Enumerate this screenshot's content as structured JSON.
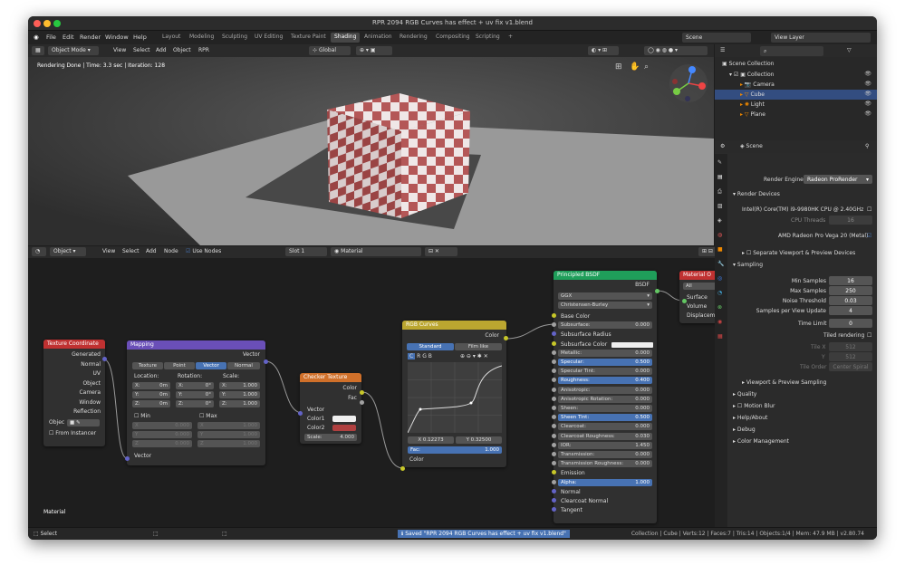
{
  "window": {
    "title": "RPR 2094 RGB Curves has effect + uv fix v1.blend"
  },
  "menu": {
    "items": [
      "File",
      "Edit",
      "Render",
      "Window",
      "Help"
    ]
  },
  "workspaces": {
    "tabs": [
      "Layout",
      "Modeling",
      "Sculpting",
      "UV Editing",
      "Texture Paint",
      "Shading",
      "Animation",
      "Rendering",
      "Compositing",
      "Scripting"
    ],
    "active": "Shading",
    "add": "+"
  },
  "topright": {
    "scene": "Scene",
    "view_layer": "View Layer"
  },
  "viewport": {
    "mode": "Object Mode",
    "menu": [
      "View",
      "Select",
      "Add",
      "Object",
      "RPR"
    ],
    "transform": "Global",
    "status": "Rendering Done | Time: 3.3 sec | Iteration: 128"
  },
  "node_editor": {
    "type": "Object",
    "menu": [
      "View",
      "Select",
      "Add",
      "Node"
    ],
    "use_nodes": "Use Nodes",
    "slot": "Slot 1",
    "material": "Material",
    "footer_label": "Material"
  },
  "nodes": {
    "texcoord": {
      "title": "Texture Coordinate",
      "outputs": [
        "Generated",
        "Normal",
        "UV",
        "Object",
        "Camera",
        "Window",
        "Reflection"
      ],
      "object_label": "Objec",
      "from_instancer": "From Instancer"
    },
    "mapping": {
      "title": "Mapping",
      "output": "Vector",
      "types": [
        "Texture",
        "Point",
        "Vector",
        "Normal"
      ],
      "active_type": "Vector",
      "headers": [
        "Location:",
        "Rotation:",
        "Scale:"
      ],
      "rows": [
        {
          "axis": "X:",
          "loc": "0m",
          "rot": "0°",
          "scale": "1.000"
        },
        {
          "axis": "Y:",
          "loc": "0m",
          "rot": "0°",
          "scale": "1.000"
        },
        {
          "axis": "Z:",
          "loc": "0m",
          "rot": "0°",
          "scale": "1.000"
        }
      ],
      "min": "Min",
      "max": "Max",
      "minmax_rows": [
        {
          "axis": "X",
          "a": "0.000",
          "b": "1.000"
        },
        {
          "axis": "Y",
          "a": "0.000",
          "b": "1.000"
        },
        {
          "axis": "Z",
          "a": "0.000",
          "b": "1.000"
        }
      ],
      "input": "Vector"
    },
    "checker": {
      "title": "Checker Texture",
      "outputs": [
        "Color",
        "Fac"
      ],
      "inputs": [
        "Vector",
        "Color1",
        "Color2"
      ],
      "scale_label": "Scale:",
      "scale_value": "4.000"
    },
    "curves": {
      "title": "RGB Curves",
      "output": "Color",
      "modes": [
        "Standard",
        "Film like"
      ],
      "active_mode": "Standard",
      "channels": [
        "C",
        "R",
        "G",
        "B"
      ],
      "x_label": "X 0.12273",
      "y_label": "Y 0.32500",
      "fac_label": "Fac:",
      "fac_value": "1.000",
      "input": "Color"
    },
    "bsdf": {
      "title": "Principled BSDF",
      "output": "BSDF",
      "dist": "GGX",
      "sss": "Christensen-Burley",
      "inputs": [
        {
          "label": "Base Color",
          "value": ""
        },
        {
          "label": "Subsurface:",
          "value": "0.000"
        },
        {
          "label": "Subsurface Radius",
          "value": ""
        },
        {
          "label": "Subsurface Color",
          "value": ""
        },
        {
          "label": "Metallic:",
          "value": "0.000"
        },
        {
          "label": "Specular:",
          "value": "0.500"
        },
        {
          "label": "Specular Tint:",
          "value": "0.000"
        },
        {
          "label": "Roughness:",
          "value": "0.400"
        },
        {
          "label": "Anisotropic:",
          "value": "0.000"
        },
        {
          "label": "Anisotropic Rotation:",
          "value": "0.000"
        },
        {
          "label": "Sheen:",
          "value": "0.000"
        },
        {
          "label": "Sheen Tint:",
          "value": "0.500"
        },
        {
          "label": "Clearcoat:",
          "value": "0.000"
        },
        {
          "label": "Clearcoat Roughness:",
          "value": "0.030"
        },
        {
          "label": "IOR:",
          "value": "1.450"
        },
        {
          "label": "Transmission:",
          "value": "0.000"
        },
        {
          "label": "Transmission Roughness:",
          "value": "0.000"
        },
        {
          "label": "Emission",
          "value": ""
        },
        {
          "label": "Alpha:",
          "value": "1.000"
        },
        {
          "label": "Normal",
          "value": ""
        },
        {
          "label": "Clearcoat Normal",
          "value": ""
        },
        {
          "label": "Tangent",
          "value": ""
        }
      ]
    },
    "output": {
      "title": "Material O",
      "target": "All",
      "inputs": [
        "Surface",
        "Volume",
        "Displaceme"
      ]
    }
  },
  "outliner": {
    "root": "Scene Collection",
    "items": [
      {
        "label": "Collection",
        "indent": 0
      },
      {
        "label": "Camera",
        "indent": 1
      },
      {
        "label": "Cube",
        "indent": 1
      },
      {
        "label": "Light",
        "indent": 1
      },
      {
        "label": "Plane",
        "indent": 1
      }
    ],
    "selected": "Cube"
  },
  "properties": {
    "scene": "Scene",
    "render_engine_label": "Render Engine",
    "render_engine": "Radeon ProRender",
    "render_devices": "Render Devices",
    "cpu": "Intel(R) Core(TM) i9-9980HK CPU @ 2.40GHz",
    "cpu_threads_label": "CPU Threads",
    "cpu_threads": "16",
    "gpu": "AMD Radeon Pro Vega 20 (Metal)",
    "separate": "Separate Viewport & Preview Devices",
    "sampling": "Sampling",
    "sampling_rows": [
      {
        "label": "Min Samples",
        "value": "16"
      },
      {
        "label": "Max Samples",
        "value": "250"
      },
      {
        "label": "Noise Threshold",
        "value": "0.03"
      },
      {
        "label": "Samples per View Update",
        "value": "4"
      }
    ],
    "time_limit_label": "Time Limit",
    "time_limit": "0",
    "tiled_rendering": "Tiled rendering",
    "tile_x_label": "Tile X",
    "tile_x": "512",
    "tile_y_label": "Y",
    "tile_y": "512",
    "tile_order_label": "Tile Order",
    "tile_order": "Center Spiral",
    "viewport_sampling": "Viewport & Preview Sampling",
    "panels": [
      "Quality",
      "Motion Blur",
      "Help/About",
      "Debug",
      "Color Management"
    ]
  },
  "statusbar": {
    "left": "Select",
    "message": "Saved \"RPR 2094 RGB Curves has effect + uv fix v1.blend\"",
    "right": "Collection | Cube | Verts:12 | Faces:7 | Tris:14 | Objects:1/4 | Mem: 47.9 MB | v2.80.74"
  },
  "colors": {
    "accent": "#4772b3",
    "checker_color1": "#f0f0f0",
    "checker_color2": "#b04040"
  }
}
